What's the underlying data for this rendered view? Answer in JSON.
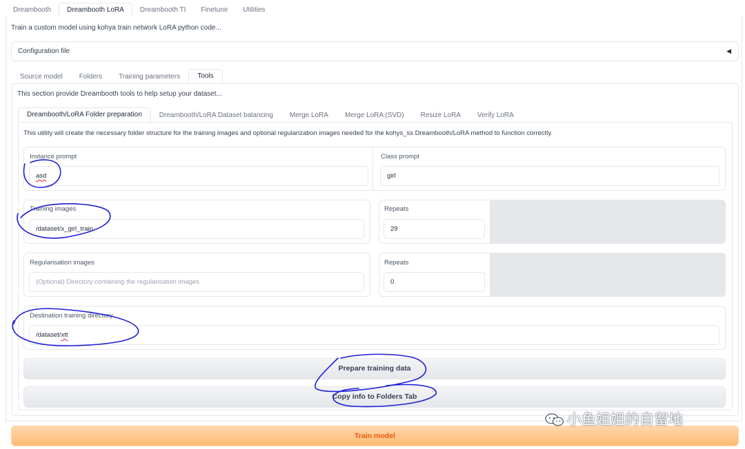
{
  "top_tabs": [
    "Dreambooth",
    "Dreambooth LoRA",
    "Dreambooth TI",
    "Finetune",
    "Utilities"
  ],
  "description": "Train a custom model using kohya train network LoRA python code...",
  "config": {
    "label": "Configuration file",
    "arrow": "◀"
  },
  "sub_tabs": [
    "Source model",
    "Folders",
    "Training parameters",
    "Tools"
  ],
  "tools_description": "This section provide Dreambooth tools to help setup your dataset...",
  "inner_tabs": [
    "Dreambooth/LoRA Folder preparation",
    "Dreambooth/LoRA Dataset balancing",
    "Merge LoRA",
    "Merge LoRA (SVD)",
    "Resize LoRA",
    "Verify LoRA"
  ],
  "utility_description": "This utility will create the necessary folder structure for the training images and optional regularization images needed for the kohys_ss Dreambooth/LoRA method to function correctly.",
  "form": {
    "instance_prompt": {
      "label": "Instance prompt",
      "value": "asd"
    },
    "class_prompt": {
      "label": "Class prompt",
      "value": "girl"
    },
    "training_images": {
      "label": "Training images",
      "value": "/dataset/x_girl_train"
    },
    "training_repeats": {
      "label": "Repeats",
      "value": "29"
    },
    "reg_images": {
      "label": "Regularisation images",
      "placeholder": "(Optional) Directory containing the regularisation images"
    },
    "reg_repeats": {
      "label": "Repeats",
      "value": "0"
    },
    "destination": {
      "label": "Destination training directory",
      "value_prefix": "/dataset/",
      "value_suffix": "xtt"
    }
  },
  "buttons": {
    "prepare": "Prepare training data",
    "copy": "Copy info to Folders Tab",
    "train": "Train model"
  },
  "watermark": "小鱼姐姐的自留地",
  "colors": {
    "train_text": "#ea580c",
    "annotation": "#1d1dd6"
  }
}
